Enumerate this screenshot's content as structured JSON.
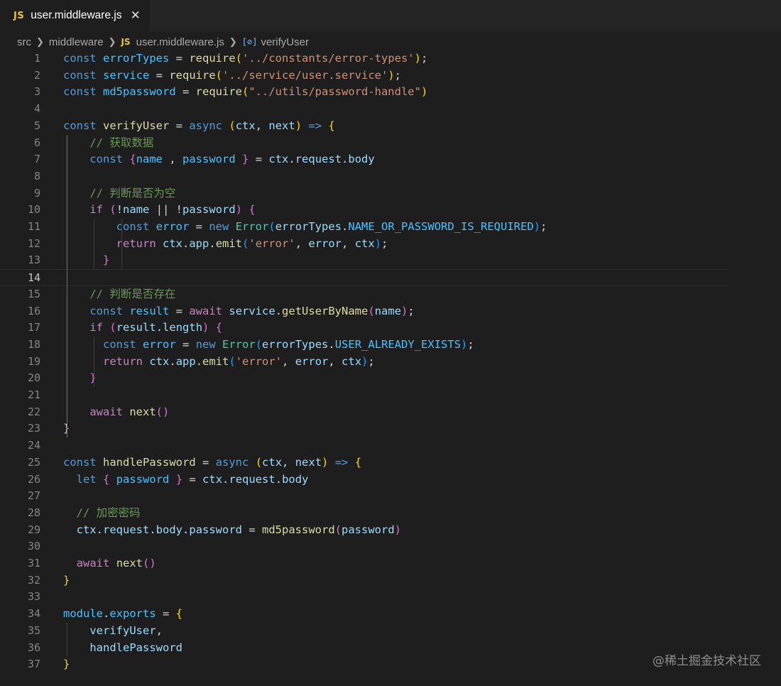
{
  "tab": {
    "badge": "JS",
    "filename": "user.middleware.js",
    "close": "✕"
  },
  "breadcrumb": {
    "items": [
      "src",
      "middleware",
      "user.middleware.js",
      "verifyUser"
    ],
    "file_badge": "JS",
    "symbol_icon": "symbol-variable-icon"
  },
  "editor": {
    "active_line": 14,
    "lines": [
      [
        [
          "k",
          "const"
        ],
        [
          "o",
          " "
        ],
        [
          "c",
          "errorTypes"
        ],
        [
          "o",
          " = "
        ],
        [
          "f",
          "require"
        ],
        [
          "b1",
          "("
        ],
        [
          "s",
          "'../constants/error-types'"
        ],
        [
          "b1",
          ")"
        ],
        [
          "o",
          ";"
        ]
      ],
      [
        [
          "k",
          "const"
        ],
        [
          "o",
          " "
        ],
        [
          "c",
          "service"
        ],
        [
          "o",
          " = "
        ],
        [
          "f",
          "require"
        ],
        [
          "b1",
          "("
        ],
        [
          "s",
          "'../service/user.service'"
        ],
        [
          "b1",
          ")"
        ],
        [
          "o",
          ";"
        ]
      ],
      [
        [
          "k",
          "const"
        ],
        [
          "o",
          " "
        ],
        [
          "c",
          "md5password"
        ],
        [
          "o",
          " = "
        ],
        [
          "f",
          "require"
        ],
        [
          "b1",
          "("
        ],
        [
          "s",
          "\"../utils/password-handle\""
        ],
        [
          "b1",
          ")"
        ]
      ],
      [],
      [
        [
          "k",
          "const"
        ],
        [
          "o",
          " "
        ],
        [
          "f",
          "verifyUser"
        ],
        [
          "o",
          " = "
        ],
        [
          "k",
          "async"
        ],
        [
          "o",
          " "
        ],
        [
          "b1",
          "("
        ],
        [
          "v",
          "ctx"
        ],
        [
          "o",
          ", "
        ],
        [
          "v",
          "next"
        ],
        [
          "b1",
          ")"
        ],
        [
          "o",
          " "
        ],
        [
          "k",
          "=>"
        ],
        [
          "o",
          " "
        ],
        [
          "b1",
          "{"
        ]
      ],
      [
        [
          "o",
          "    "
        ],
        [
          "m",
          "// 获取数据"
        ]
      ],
      [
        [
          "o",
          "    "
        ],
        [
          "k",
          "const"
        ],
        [
          "o",
          " "
        ],
        [
          "b2",
          "{"
        ],
        [
          "c",
          "name"
        ],
        [
          "o",
          " , "
        ],
        [
          "c",
          "password"
        ],
        [
          "o",
          " "
        ],
        [
          "b2",
          "}"
        ],
        [
          "o",
          " = "
        ],
        [
          "v",
          "ctx"
        ],
        [
          "o",
          "."
        ],
        [
          "v",
          "request"
        ],
        [
          "o",
          "."
        ],
        [
          "v",
          "body"
        ]
      ],
      [],
      [
        [
          "o",
          "    "
        ],
        [
          "m",
          "// 判断是否为空"
        ]
      ],
      [
        [
          "o",
          "    "
        ],
        [
          "ctl",
          "if"
        ],
        [
          "o",
          " "
        ],
        [
          "b2",
          "("
        ],
        [
          "o",
          "!"
        ],
        [
          "v",
          "name"
        ],
        [
          "o",
          " || !"
        ],
        [
          "v",
          "password"
        ],
        [
          "b2",
          ")"
        ],
        [
          "o",
          " "
        ],
        [
          "b2",
          "{"
        ]
      ],
      [
        [
          "o",
          "        "
        ],
        [
          "k",
          "const"
        ],
        [
          "o",
          " "
        ],
        [
          "c",
          "error"
        ],
        [
          "o",
          " = "
        ],
        [
          "k",
          "new"
        ],
        [
          "o",
          " "
        ],
        [
          "t",
          "Error"
        ],
        [
          "b3",
          "("
        ],
        [
          "v",
          "errorTypes"
        ],
        [
          "o",
          "."
        ],
        [
          "c",
          "NAME_OR_PASSWORD_IS_REQUIRED"
        ],
        [
          "b3",
          ")"
        ],
        [
          "o",
          ";"
        ]
      ],
      [
        [
          "o",
          "        "
        ],
        [
          "ctl",
          "return"
        ],
        [
          "o",
          " "
        ],
        [
          "v",
          "ctx"
        ],
        [
          "o",
          "."
        ],
        [
          "v",
          "app"
        ],
        [
          "o",
          "."
        ],
        [
          "f",
          "emit"
        ],
        [
          "b3",
          "("
        ],
        [
          "s",
          "'error'"
        ],
        [
          "o",
          ", "
        ],
        [
          "v",
          "error"
        ],
        [
          "o",
          ", "
        ],
        [
          "v",
          "ctx"
        ],
        [
          "b3",
          ")"
        ],
        [
          "o",
          ";"
        ]
      ],
      [
        [
          "o",
          "      "
        ],
        [
          "b2",
          "}"
        ]
      ],
      [],
      [
        [
          "o",
          "    "
        ],
        [
          "m",
          "// 判断是否存在"
        ]
      ],
      [
        [
          "o",
          "    "
        ],
        [
          "k",
          "const"
        ],
        [
          "o",
          " "
        ],
        [
          "c",
          "result"
        ],
        [
          "o",
          " = "
        ],
        [
          "ctl",
          "await"
        ],
        [
          "o",
          " "
        ],
        [
          "v",
          "service"
        ],
        [
          "o",
          "."
        ],
        [
          "f",
          "getUserByName"
        ],
        [
          "b2",
          "("
        ],
        [
          "v",
          "name"
        ],
        [
          "b2",
          ")"
        ],
        [
          "o",
          ";"
        ]
      ],
      [
        [
          "o",
          "    "
        ],
        [
          "ctl",
          "if"
        ],
        [
          "o",
          " "
        ],
        [
          "b2",
          "("
        ],
        [
          "v",
          "result"
        ],
        [
          "o",
          "."
        ],
        [
          "v",
          "length"
        ],
        [
          "b2",
          ")"
        ],
        [
          "o",
          " "
        ],
        [
          "b2",
          "{"
        ]
      ],
      [
        [
          "o",
          "      "
        ],
        [
          "k",
          "const"
        ],
        [
          "o",
          " "
        ],
        [
          "c",
          "error"
        ],
        [
          "o",
          " = "
        ],
        [
          "k",
          "new"
        ],
        [
          "o",
          " "
        ],
        [
          "t",
          "Error"
        ],
        [
          "b3",
          "("
        ],
        [
          "v",
          "errorTypes"
        ],
        [
          "o",
          "."
        ],
        [
          "c",
          "USER_ALREADY_EXISTS"
        ],
        [
          "b3",
          ")"
        ],
        [
          "o",
          ";"
        ]
      ],
      [
        [
          "o",
          "      "
        ],
        [
          "ctl",
          "return"
        ],
        [
          "o",
          " "
        ],
        [
          "v",
          "ctx"
        ],
        [
          "o",
          "."
        ],
        [
          "v",
          "app"
        ],
        [
          "o",
          "."
        ],
        [
          "f",
          "emit"
        ],
        [
          "b3",
          "("
        ],
        [
          "s",
          "'error'"
        ],
        [
          "o",
          ", "
        ],
        [
          "v",
          "error"
        ],
        [
          "o",
          ", "
        ],
        [
          "v",
          "ctx"
        ],
        [
          "b3",
          ")"
        ],
        [
          "o",
          ";"
        ]
      ],
      [
        [
          "o",
          "    "
        ],
        [
          "b2",
          "}"
        ]
      ],
      [],
      [
        [
          "o",
          "    "
        ],
        [
          "ctl",
          "await"
        ],
        [
          "o",
          " "
        ],
        [
          "f",
          "next"
        ],
        [
          "b2",
          "()"
        ]
      ],
      [
        [
          "b1",
          "}"
        ]
      ],
      [],
      [
        [
          "k",
          "const"
        ],
        [
          "o",
          " "
        ],
        [
          "f",
          "handlePassword"
        ],
        [
          "o",
          " = "
        ],
        [
          "k",
          "async"
        ],
        [
          "o",
          " "
        ],
        [
          "b1",
          "("
        ],
        [
          "v",
          "ctx"
        ],
        [
          "o",
          ", "
        ],
        [
          "v",
          "next"
        ],
        [
          "b1",
          ")"
        ],
        [
          "o",
          " "
        ],
        [
          "k",
          "=>"
        ],
        [
          "o",
          " "
        ],
        [
          "b1",
          "{"
        ]
      ],
      [
        [
          "o",
          "  "
        ],
        [
          "k",
          "let"
        ],
        [
          "o",
          " "
        ],
        [
          "b2",
          "{"
        ],
        [
          "o",
          " "
        ],
        [
          "c",
          "password"
        ],
        [
          "o",
          " "
        ],
        [
          "b2",
          "}"
        ],
        [
          "o",
          " = "
        ],
        [
          "v",
          "ctx"
        ],
        [
          "o",
          "."
        ],
        [
          "v",
          "request"
        ],
        [
          "o",
          "."
        ],
        [
          "v",
          "body"
        ]
      ],
      [],
      [
        [
          "o",
          "  "
        ],
        [
          "m",
          "// 加密密码"
        ]
      ],
      [
        [
          "o",
          "  "
        ],
        [
          "v",
          "ctx"
        ],
        [
          "o",
          "."
        ],
        [
          "v",
          "request"
        ],
        [
          "o",
          "."
        ],
        [
          "v",
          "body"
        ],
        [
          "o",
          "."
        ],
        [
          "v",
          "password"
        ],
        [
          "o",
          " = "
        ],
        [
          "f",
          "md5password"
        ],
        [
          "b2",
          "("
        ],
        [
          "v",
          "password"
        ],
        [
          "b2",
          ")"
        ]
      ],
      [],
      [
        [
          "o",
          "  "
        ],
        [
          "ctl",
          "await"
        ],
        [
          "o",
          " "
        ],
        [
          "f",
          "next"
        ],
        [
          "b2",
          "()"
        ]
      ],
      [
        [
          "b1",
          "}"
        ]
      ],
      [],
      [
        [
          "c",
          "module"
        ],
        [
          "o",
          "."
        ],
        [
          "c",
          "exports"
        ],
        [
          "o",
          " = "
        ],
        [
          "b1",
          "{"
        ]
      ],
      [
        [
          "o",
          "    "
        ],
        [
          "v",
          "verifyUser"
        ],
        [
          "o",
          ","
        ]
      ],
      [
        [
          "o",
          "    "
        ],
        [
          "v",
          "handlePassword"
        ]
      ],
      [
        [
          "b1",
          "}"
        ]
      ]
    ]
  },
  "watermark": "@稀土掘金技术社区"
}
